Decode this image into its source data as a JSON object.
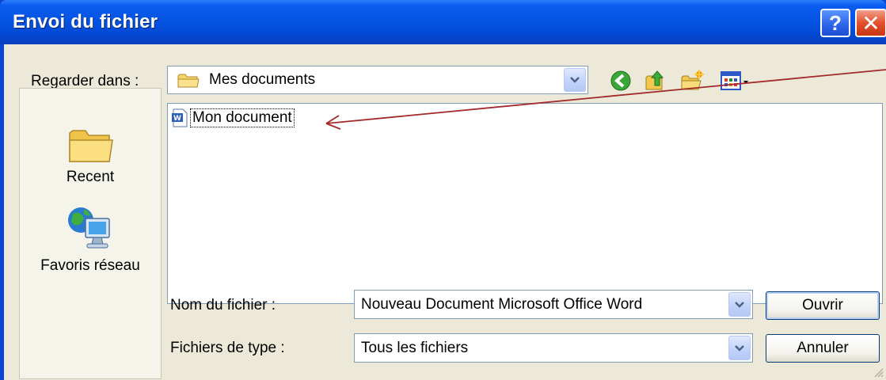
{
  "window": {
    "title": "Envoi du fichier",
    "help_label": "?",
    "close_label": "✕"
  },
  "lookin": {
    "label": "Regarder dans :",
    "value": "Mes documents"
  },
  "toolbar": {
    "icons": [
      "back-icon",
      "up-folder-icon",
      "new-folder-icon",
      "views-menu-icon"
    ]
  },
  "places": [
    {
      "label": "Recent",
      "icon": "folder-icon"
    },
    {
      "label": "Favoris réseau",
      "icon": "network-computer-icon"
    }
  ],
  "files": [
    {
      "name": "Mon document",
      "icon": "word-document-icon"
    }
  ],
  "filename": {
    "label": "Nom du fichier :",
    "value": "Nouveau Document Microsoft Office Word"
  },
  "filetype": {
    "label": "Fichiers de type :",
    "value": "Tous les fichiers"
  },
  "buttons": {
    "open": "Ouvrir",
    "cancel": "Annuler"
  },
  "colors": {
    "titlebar": "#0554e3",
    "client": "#ece9d8",
    "annotation_arrow": "#a32a2a"
  }
}
